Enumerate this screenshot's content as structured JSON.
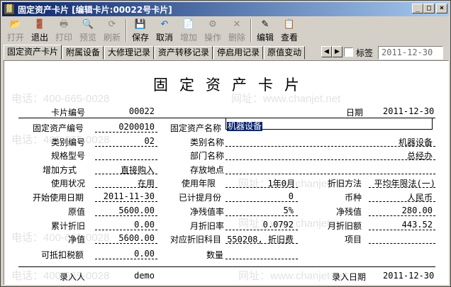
{
  "window": {
    "title": "固定资产卡片 [编辑卡片:00022号卡片]",
    "app_icon_glyph": "▓",
    "buttons": {
      "min": "_",
      "max": "□",
      "close": "×"
    }
  },
  "toolbar": {
    "print": "打开",
    "exit": "退出",
    "print2": "打印",
    "preview": "预览",
    "refresh": "刷新",
    "save": "保存",
    "cancel": "取消",
    "add": "增加",
    "operate": "操作",
    "delete": "删除",
    "edit": "编辑",
    "view": "查看"
  },
  "tabs": [
    "固定资产卡片",
    "附属设备",
    "大修理记录",
    "资产转移记录",
    "停启用记录",
    "原值变动"
  ],
  "tab_nav": {
    "left": "◀",
    "right": "▶"
  },
  "tag_label": "标签",
  "top_date": "2011-12-30",
  "card": {
    "title": "固定资产卡片",
    "card_no_label": "卡片编号",
    "card_no": "00022",
    "date_label": "日期",
    "date": "2011-12-30",
    "asset_code_label": "固定资产编号",
    "asset_code": "0200010",
    "asset_name_label": "固定资产名称",
    "asset_name": "机器设备",
    "category_code_label": "类别编号",
    "category_code": "02",
    "category_name_label": "类别名称",
    "category_name": "机器设备",
    "spec_label": "规格型号",
    "spec": "",
    "dept_label": "部门名称",
    "dept": "总经办",
    "add_method_label": "增加方式",
    "add_method": "直接购入",
    "location_label": "存放地点",
    "location": "",
    "use_status_label": "使用状况",
    "use_status": "在用",
    "use_years_label": "使用年限",
    "use_years": "1年0月",
    "depr_method_label": "折旧方法",
    "depr_method": "平均年限法(一)",
    "start_date_label": "开始使用日期",
    "start_date": "2011-11-30",
    "months_label": "已计提月份",
    "months": "0",
    "currency_label": "币种",
    "currency": "人民币",
    "orig_value_label": "原值",
    "orig_value": "5600.00",
    "salvage_rate_label": "净残值率",
    "salvage_rate": "5%",
    "salvage_label": "净残值",
    "salvage": "280.00",
    "accum_depr_label": "累计折旧",
    "accum_depr": "0.00",
    "month_rate_label": "月折旧率",
    "month_rate": "0.0792",
    "month_amount_label": "月折旧额",
    "month_amount": "443.52",
    "net_value_label": "净值",
    "net_value": "5600.00",
    "depr_account_label": "对应折旧科目",
    "depr_account": "550208, 折旧费",
    "project_label": "项目",
    "project": "",
    "tax_label": "可抵扣税额",
    "tax": "0.00",
    "qty_label": "数量",
    "qty": "",
    "entry_person_label": "录入人",
    "entry_person": "demo",
    "entry_date_label": "录入日期",
    "entry_date": "2011-12-30"
  },
  "watermarks": [
    "电话：400-665-0028",
    "网址：www.chanjet.net",
    "电话：400-665-0028",
    "网址：www.chanjet.net",
    "电话：400-665-0028",
    "网址：www.chanjet.net",
    "电话：400-665-0028",
    "网址：www.chanjet.net"
  ]
}
